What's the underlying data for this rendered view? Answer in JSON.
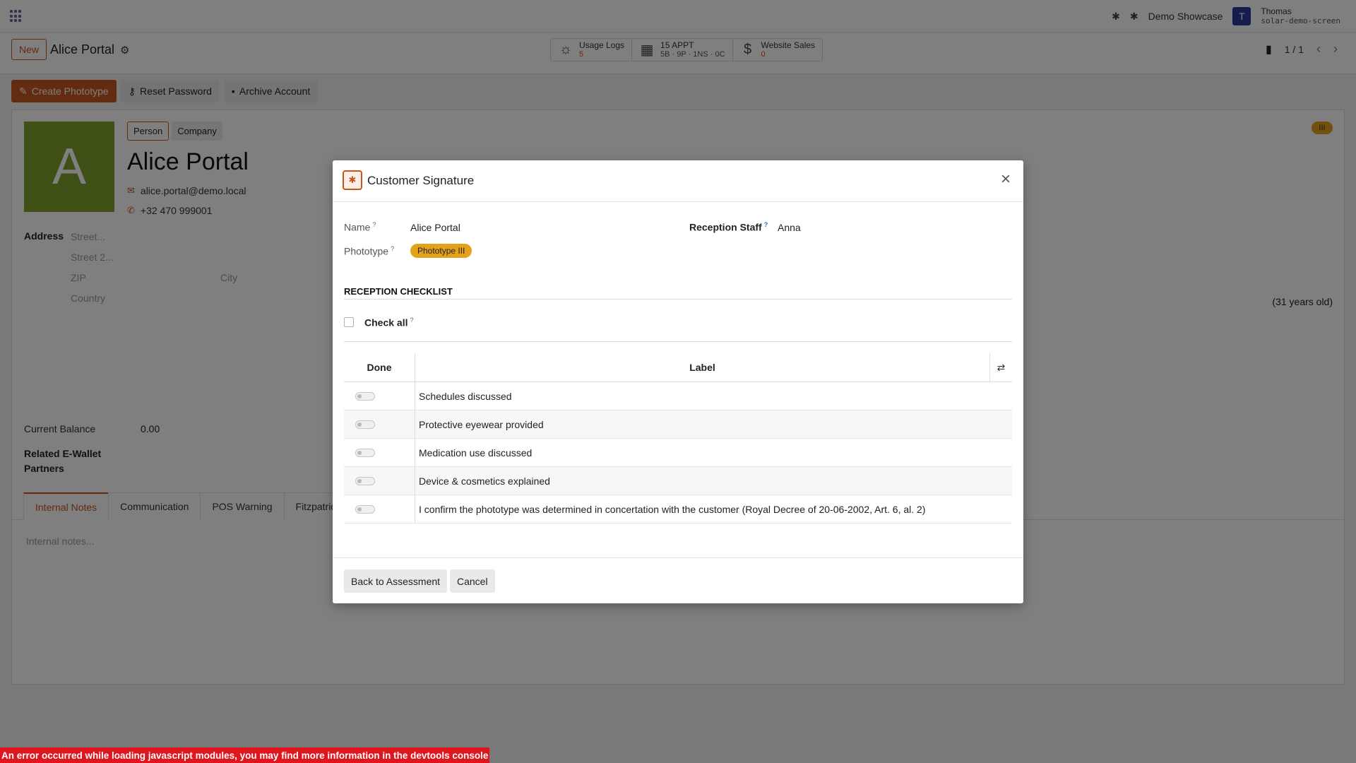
{
  "navbar": {
    "company": "Demo Showcase",
    "user_initial": "T",
    "user_name": "Thomas",
    "user_db": "solar-demo-screen"
  },
  "control": {
    "new_label": "New",
    "record_title": "Alice Portal",
    "smart_buttons": [
      {
        "label": "Usage Logs",
        "value": "5",
        "icon": "sun-icon"
      },
      {
        "label": "15 APPT",
        "value": "5B · 9P · 1NS · 0C",
        "icon": "calendar-icon"
      },
      {
        "label": "Website Sales",
        "value": "0",
        "icon": "dollar-icon"
      }
    ],
    "pager": "1 / 1"
  },
  "actions": {
    "create_phototype": "Create Phototype",
    "reset_password": "Reset Password",
    "archive_account": "Archive Account"
  },
  "form": {
    "avatar_letter": "A",
    "type_person": "Person",
    "type_company": "Company",
    "name": "Alice Portal",
    "email": "alice.portal@demo.local",
    "phone": "+32 470 999001",
    "address_label": "Address",
    "street_placeholder": "Street...",
    "street2_placeholder": "Street 2...",
    "zip_placeholder": "ZIP",
    "city_placeholder": "City",
    "country_placeholder": "Country",
    "age": "(31 years old)",
    "badge": "III",
    "current_balance_label": "Current Balance",
    "current_balance_value": "0.00",
    "ewallet_label_1": "Related E-Wallet",
    "ewallet_label_2": "Partners",
    "tabs": [
      "Internal Notes",
      "Communication",
      "POS Warning",
      "Fitzpatric"
    ],
    "notes_placeholder": "Internal notes..."
  },
  "modal": {
    "title": "Customer Signature",
    "name_label": "Name",
    "name_value": "Alice Portal",
    "staff_label": "Reception Staff",
    "staff_value": "Anna",
    "phototype_label": "Phototype",
    "phototype_value": "Phototype III",
    "section_title": "RECEPTION CHECKLIST",
    "check_all": "Check all",
    "col_done": "Done",
    "col_label": "Label",
    "rows": [
      "Schedules discussed",
      "Protective eyewear provided",
      "Medication use discussed",
      "Device & cosmetics explained",
      "I confirm the phototype was determined in concertation with the customer (Royal Decree of 20-06-2002, Art. 6, al. 2)"
    ],
    "back_button": "Back to Assessment",
    "cancel_button": "Cancel"
  },
  "error_message": "An error occurred while loading javascript modules, you may find more information in the devtools console",
  "colors": {
    "brand": "#c7561e",
    "phototype": "#e3a21a",
    "avatar": "#7ea12f",
    "error": "#e0161e"
  }
}
